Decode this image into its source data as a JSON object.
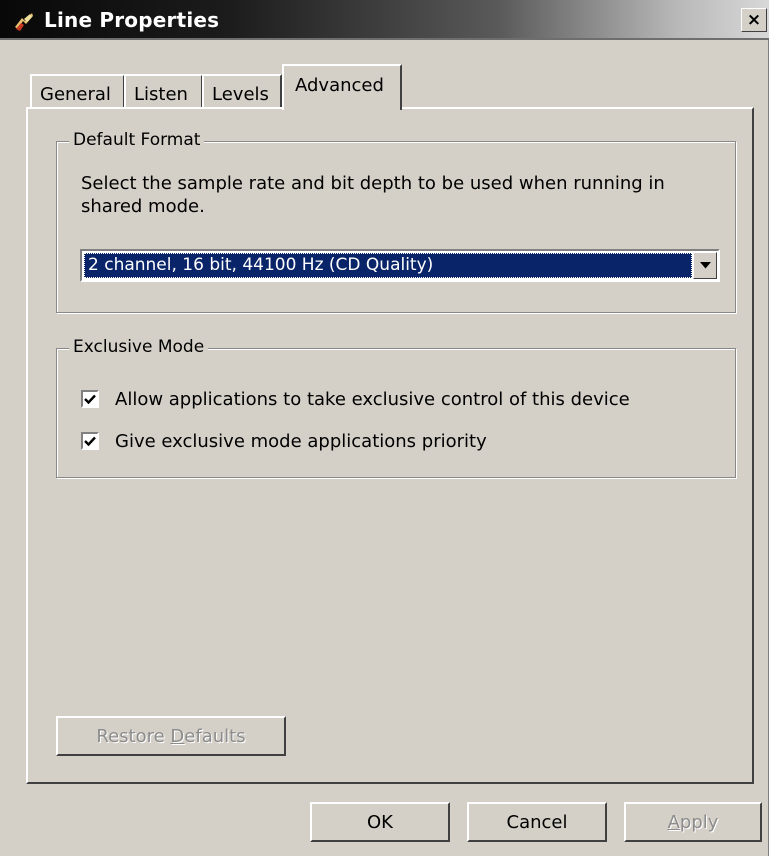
{
  "window": {
    "title": "Line Properties",
    "close_glyph": "×",
    "icon": "speaker-line-icon"
  },
  "tabs": [
    {
      "label": "General",
      "active": false
    },
    {
      "label": "Listen",
      "active": false
    },
    {
      "label": "Levels",
      "active": false
    },
    {
      "label": "Advanced",
      "active": true
    }
  ],
  "default_format": {
    "legend": "Default Format",
    "description": "Select the sample rate and bit depth to be used when running in shared mode.",
    "selected_format": "2 channel, 16 bit, 44100 Hz (CD Quality)"
  },
  "exclusive_mode": {
    "legend": "Exclusive Mode",
    "options": [
      {
        "label": "Allow applications to take exclusive control of this device",
        "checked": true
      },
      {
        "label": "Give exclusive mode applications priority",
        "checked": true
      }
    ]
  },
  "buttons": {
    "restore_defaults_pre": "Restore ",
    "restore_defaults_accel": "D",
    "restore_defaults_post": "efaults",
    "ok": "OK",
    "cancel": "Cancel",
    "apply_accel": "A",
    "apply_post": "pply"
  },
  "colors": {
    "dialog_face": "#d4d0c8",
    "selection": "#0a246a",
    "disabled_text": "#8c8c8c"
  }
}
